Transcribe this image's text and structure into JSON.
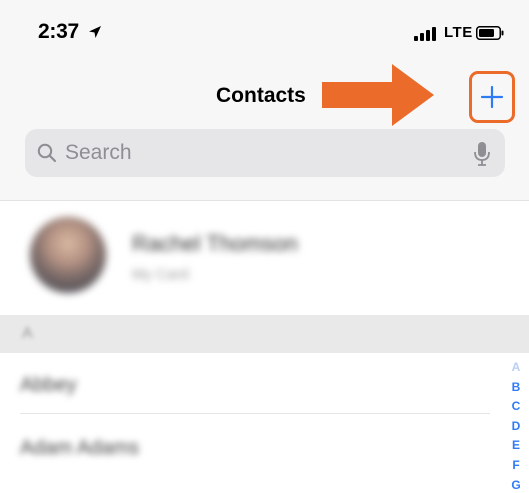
{
  "status_bar": {
    "time": "2:37",
    "network": "LTE"
  },
  "nav": {
    "title": "Contacts",
    "add_label": "+"
  },
  "search": {
    "placeholder": "Search"
  },
  "my_card": {
    "name": "Rachel Thomson",
    "subtitle": "My Card"
  },
  "sections": [
    {
      "letter": "A",
      "contacts": [
        "Abbey",
        "Adam Adams"
      ]
    }
  ],
  "index_letters": [
    "A",
    "B",
    "C",
    "D",
    "E",
    "F",
    "G"
  ],
  "colors": {
    "accent": "#2f7bf6",
    "callout": "#ea6b2a"
  }
}
